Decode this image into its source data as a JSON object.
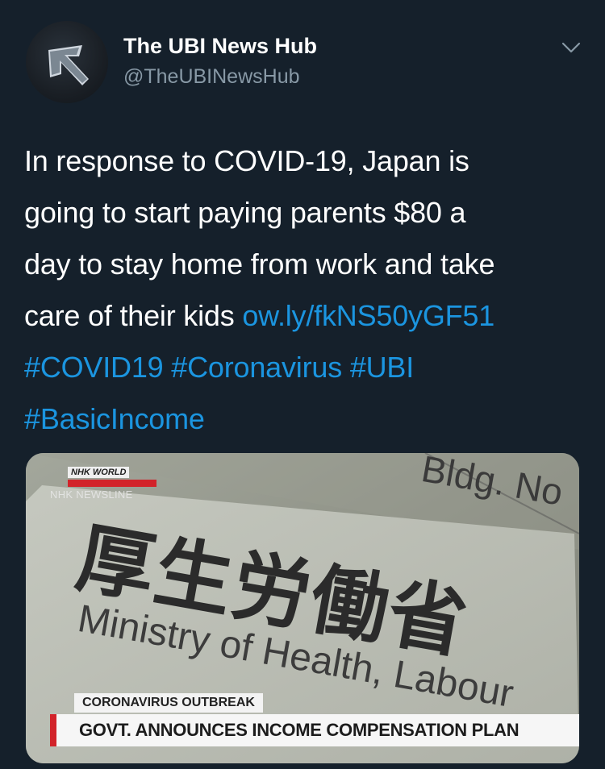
{
  "author": {
    "name": "The UBI News Hub",
    "handle": "@TheUBINewsHub",
    "avatar_icon": "arrow-up-left-icon"
  },
  "menu": {
    "icon": "chevron-down-icon"
  },
  "tweet": {
    "line1": "In response to COVID-19, Japan is",
    "line2": "going to start paying parents $80 a",
    "line3": "day to stay home from work and take",
    "line4_text": "care of their kids ",
    "link": "ow.ly/fkNS50yGF51",
    "hashtags_line5": [
      "#COVID19",
      "#Coronavirus",
      "#UBI"
    ],
    "hashtag_line6": "#BasicIncome"
  },
  "media": {
    "logo_top": "NHK WORLD",
    "logo_sub": "JAPAN",
    "newsline": "NHK NEWSLINE",
    "sign_kanji": "厚生労働省",
    "sign_english": "Ministry of Health, Labour",
    "sign_bldg": "Bldg. No",
    "tag": "CORONAVIRUS OUTBREAK",
    "headline": "GOVT. ANNOUNCES INCOME COMPENSATION PLAN"
  },
  "colors": {
    "background": "#15202b",
    "link": "#1b95e0",
    "secondary_text": "#8899a6",
    "news_accent": "#d2232a"
  }
}
